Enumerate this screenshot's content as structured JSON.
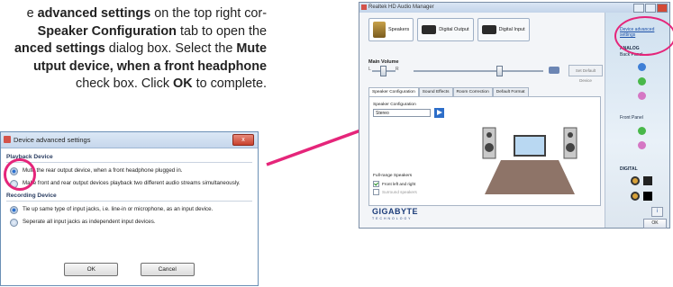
{
  "doc": {
    "lines": [
      [
        "e ",
        {
          "b": "advanced settings"
        },
        " on the top right cor-"
      ],
      [
        {
          "b": "Speaker Configuration"
        },
        " tab to open the"
      ],
      [
        {
          "b": "anced settings"
        },
        " dialog box. Select the ",
        {
          "b": "Mute"
        }
      ],
      [
        {
          "b": "utput device, when a front headphone"
        }
      ],
      [
        "check box. Click ",
        {
          "b": "OK"
        },
        " to complete."
      ]
    ]
  },
  "dialog": {
    "title": "Device advanced settings",
    "close": "x",
    "playback_heading": "Playback Device",
    "option1": "Mute the rear output device, when a front headphone plugged in.",
    "option2": "Make front and rear output devices playback two different audio streams simultaneously.",
    "recording_heading": "Recording Device",
    "option3": "Tie up same type of input jacks, i.e. line-in or microphone, as an input device.",
    "option4": "Seperate all input jacks as independent input devices.",
    "ok": "OK",
    "cancel": "Cancel"
  },
  "window": {
    "title": "Realtek HD Audio Manager",
    "tab_speakers": "Speakers",
    "tab_digital_output": "Digital Output",
    "tab_digital_input": "Digital Input",
    "main_volume": "Main Volume",
    "vol_l": "L",
    "vol_r": "R",
    "set_default": "Set Default Device",
    "subtabs": [
      "Speaker Configuration",
      "Sound Effects",
      "Room Correction",
      "Default Format"
    ],
    "speaker_config_label": "Speaker Configuration",
    "speaker_config_value": "Stereo",
    "fullrange_label": "Full-range Speakers",
    "front_lr": "Front left and right",
    "surround": "Surround speakers",
    "brand": "GIGABYTE",
    "brand_sub": "TECHNOLOGY",
    "adv_link": "Device advanced settings",
    "analog": "ANALOG",
    "back_panel": "Back Panel",
    "front_panel": "Front Panel",
    "digital": "DIGITAL",
    "info": "i",
    "ok": "OK"
  },
  "colors": {
    "highlight": "#e5257a",
    "jack_blue": "#3e7fd6",
    "jack_green": "#49b84a",
    "jack_pink": "#d577c4"
  }
}
